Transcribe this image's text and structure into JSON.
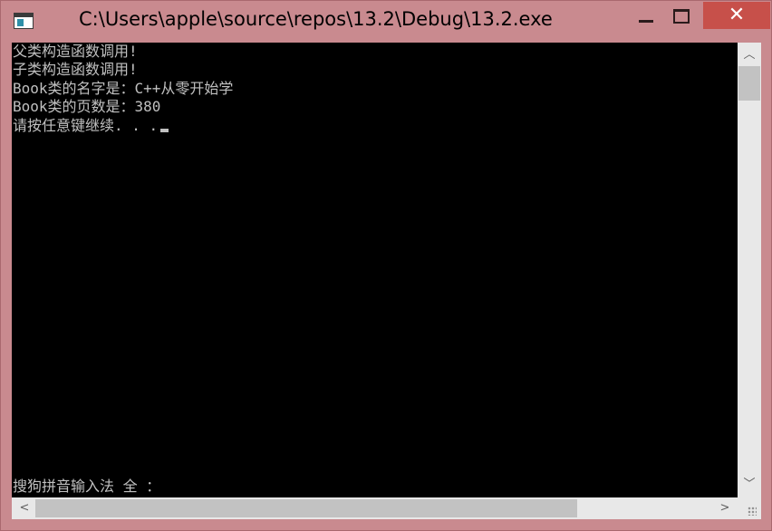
{
  "window": {
    "title": "C:\\Users\\apple\\source\\repos\\13.2\\Debug\\13.2.exe",
    "frame_color": "#c98a8f",
    "close_color": "#c7504a"
  },
  "titlebar": {
    "icon": "console-app-icon",
    "minimize_icon": "minimize-icon",
    "maximize_icon": "maximize-icon",
    "close_icon": "close-icon",
    "close_glyph": "✕"
  },
  "console": {
    "background": "#000000",
    "text_color": "#c0c0c0",
    "lines": [
      "父类构造函数调用!",
      "子类构造函数调用!",
      "Book类的名字是：C++从零开始学",
      "Book类的页数是：380",
      "请按任意键继续. . ."
    ],
    "ime_status": "搜狗拼音输入法 全 ："
  },
  "scrollbars": {
    "up_glyph": "︿",
    "down_glyph": "﹀",
    "left_glyph": "<",
    "right_glyph": ">"
  }
}
